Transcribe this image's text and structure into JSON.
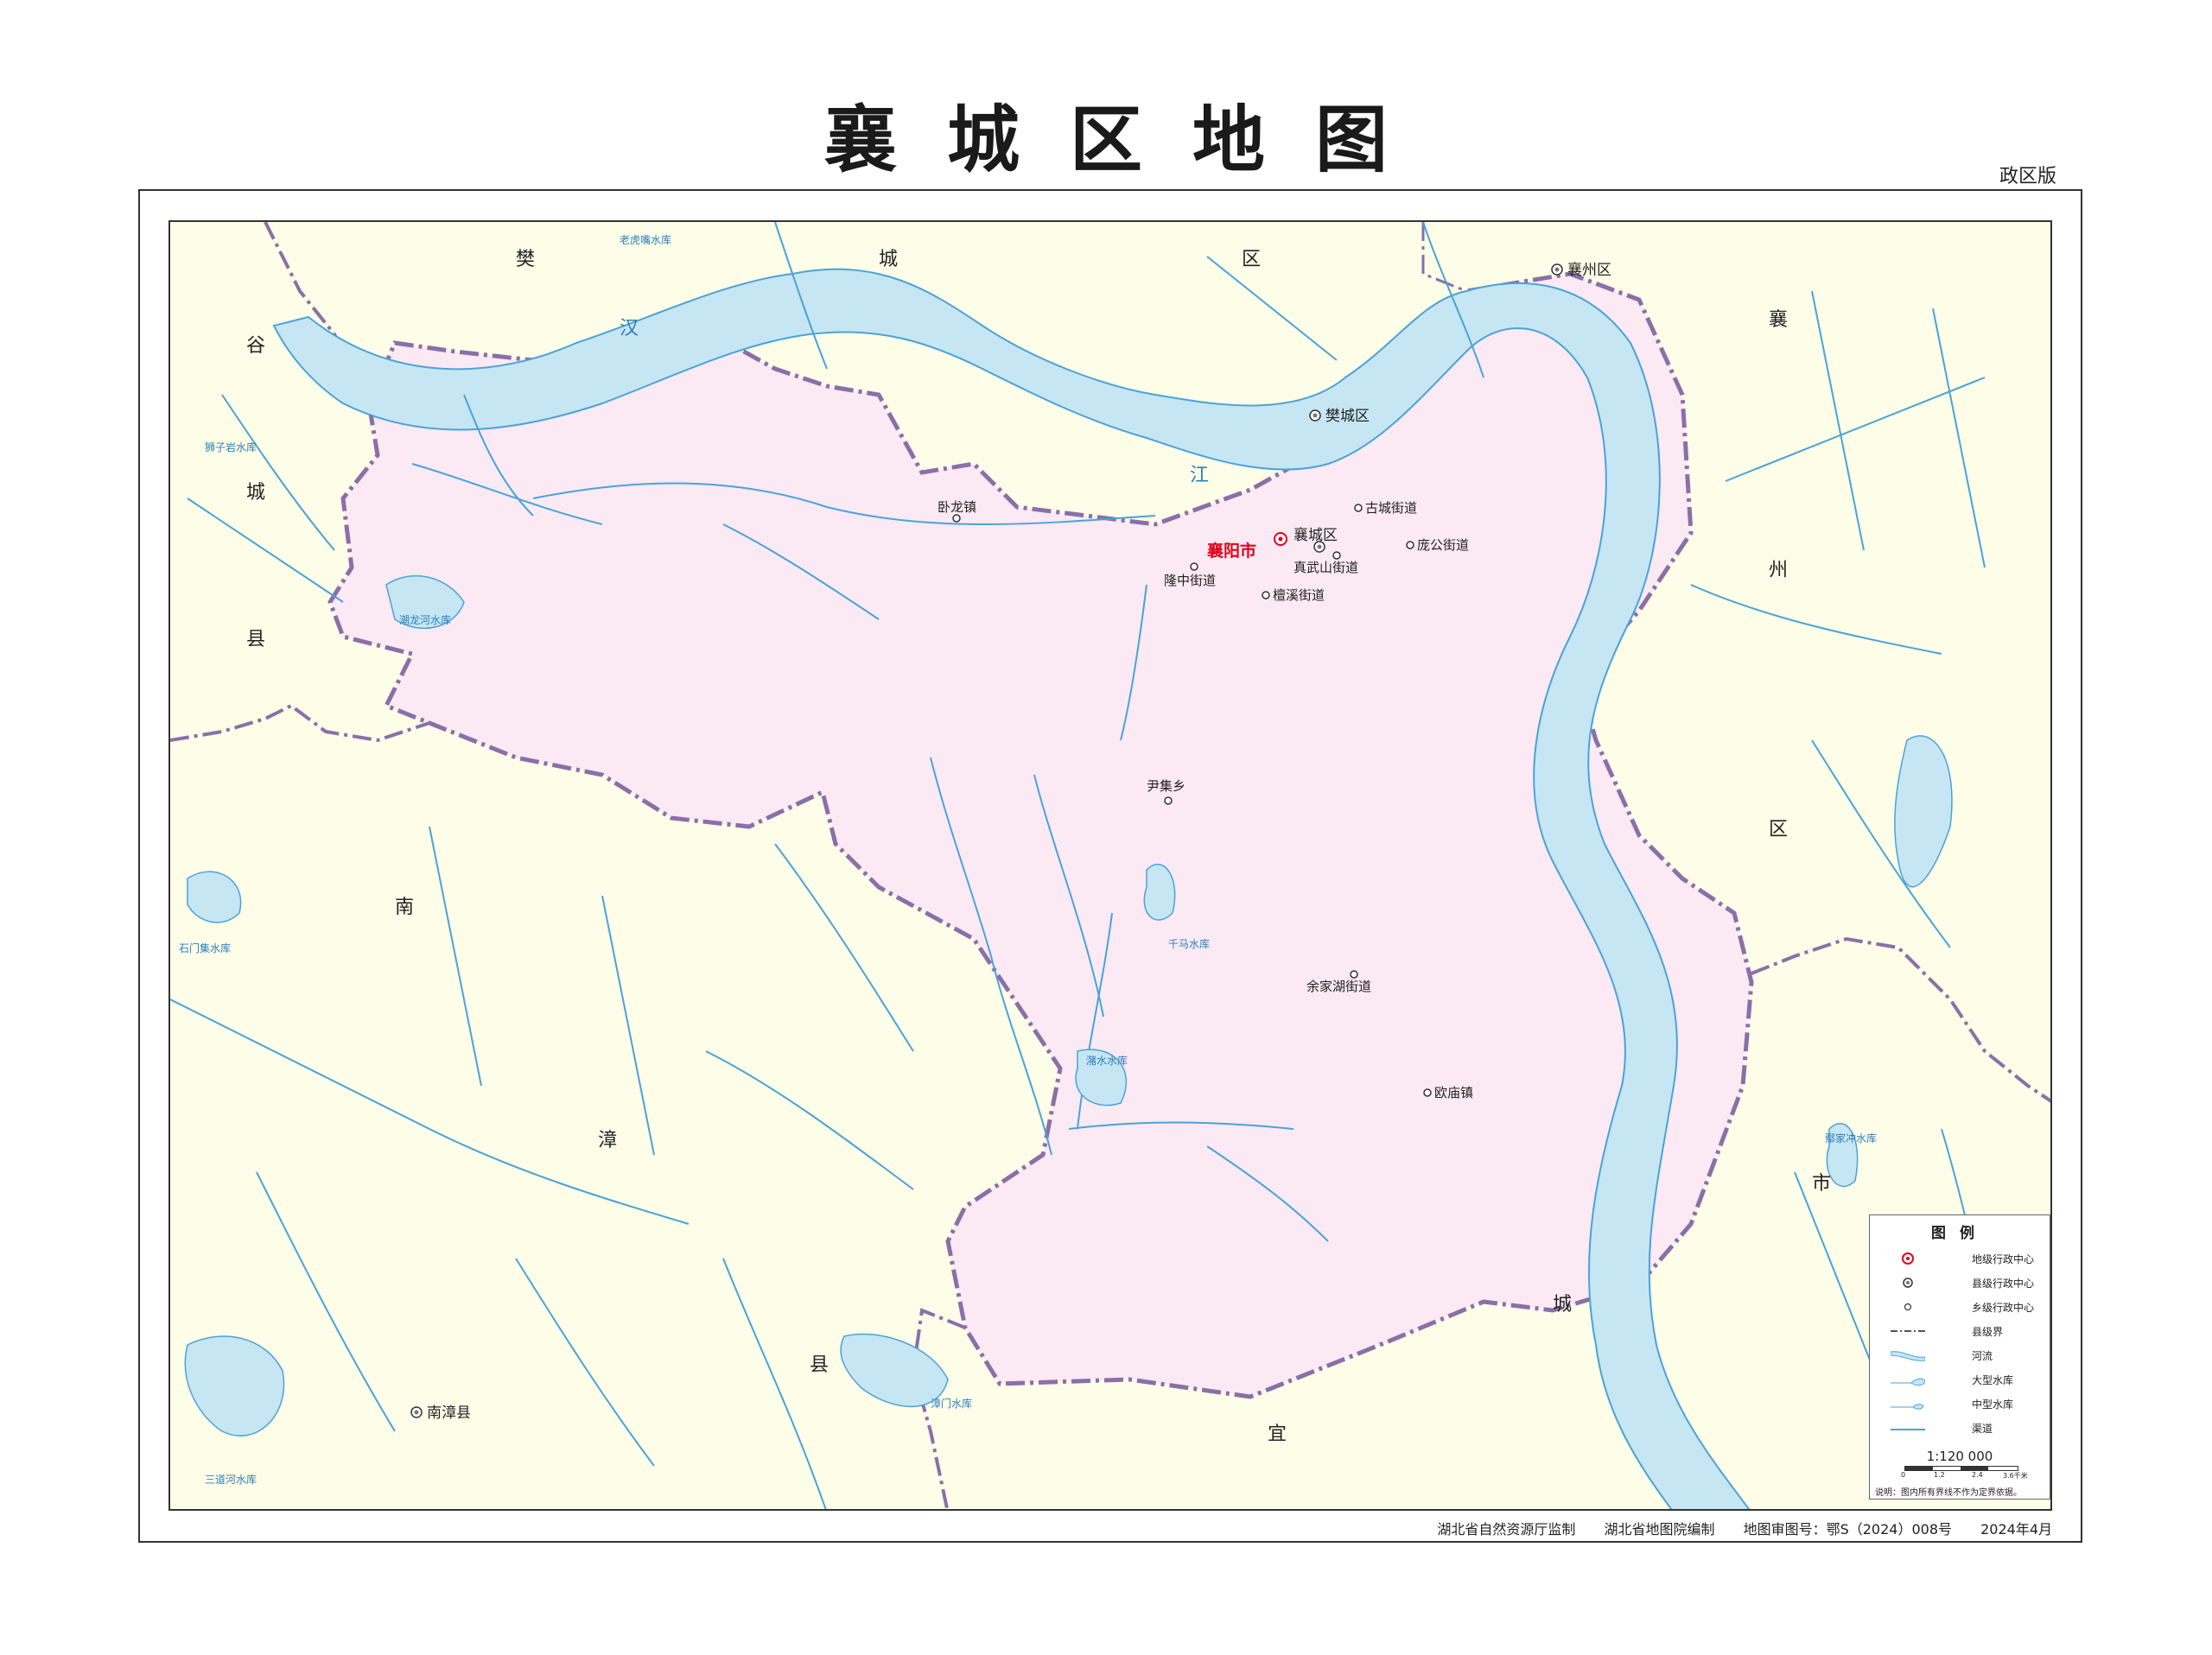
{
  "title": "襄城区地图",
  "edition": "政区版",
  "colors": {
    "background": "#fdfde8",
    "district_fill": "#fbeaf4",
    "boundary": "#8a6fa8",
    "water": "#c7e6f3",
    "river": "#4aa3d8",
    "city_red": "#e3001b"
  },
  "labels": {
    "fancheng_area": [
      "樊",
      "城",
      "区"
    ],
    "xiangzhou_area": [
      "襄",
      "州",
      "区"
    ],
    "gucheng_county": [
      "谷",
      "城",
      "县"
    ],
    "nanzhang_county": [
      "南",
      "漳",
      "县"
    ],
    "yicheng_city": [
      "宜",
      "城",
      "市"
    ],
    "hanjiang": [
      "汉",
      "江"
    ]
  },
  "places": {
    "xiangyang_city": "襄阳市",
    "xiangcheng_district": "襄城区",
    "fancheng_district": "樊城区",
    "xiangzhou_district": "襄州区",
    "nanzhang_county": "南漳县",
    "wolong": "卧龙镇",
    "gucheng_st": "古城街道",
    "panggong_st": "庞公街道",
    "zhenwushan_st": "真武山街道",
    "longzhong_st": "隆中街道",
    "tanxi_st": "檀溪街道",
    "yinji": "尹集乡",
    "yujiahu_st": "余家湖街道",
    "oumiao": "欧庙镇"
  },
  "reservoirs": {
    "shiziyan": "狮子岩水库",
    "laohuzui": "老虎嘴水库",
    "chilong": "潮龙河水库",
    "shimenji": "石门集水库",
    "qianma": "千马水库",
    "zhuzhuan": "潴水水库",
    "yaojiachong": "鄢家冲水库",
    "sandaohe": "三道河水库",
    "zhangmen": "漳门水库"
  },
  "legend": {
    "title": "图例",
    "items": [
      "地级行政中心",
      "县级行政中心",
      "乡级行政中心",
      "县级界",
      "河流",
      "大型水库",
      "中型水库",
      "渠道"
    ],
    "scale": "1:120 000",
    "scale_ticks": [
      "0",
      "1.2",
      "2.4",
      "3.6千米"
    ],
    "note": "说明：图内所有界线不作为定界依据。"
  },
  "footer": {
    "supervisor": "湖北省自然资源厅监制",
    "compiler": "湖北省地图院编制",
    "review_no": "地图审图号：鄂S（2024）008号",
    "date": "2024年4月"
  }
}
